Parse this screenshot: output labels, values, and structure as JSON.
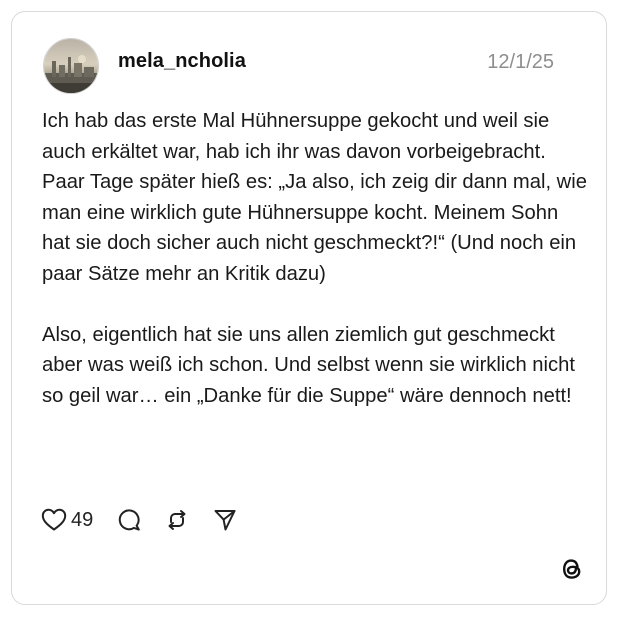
{
  "post": {
    "username": "mela_ncholia",
    "date": "12/1/25",
    "text": "Ich hab das erste Mal Hühnersuppe gekocht und weil sie auch erkältet war, hab ich ihr was davon vorbeigebracht. Paar Tage später hieß es: „Ja also, ich zeig dir dann mal, wie man eine wirklich gute Hühnersuppe kocht. Meinem Sohn hat sie doch sicher auch nicht geschmeckt?!“ (Und noch ein paar Sätze mehr an Kritik dazu)\n\nAlso, eigentlich hat sie uns allen ziemlich gut geschmeckt aber was weiß ich schon. Und selbst wenn sie wirklich nicht so geil war… ein „Danke für die Suppe“ wäre dennoch nett!",
    "like_count": "49"
  },
  "icons": {
    "avatar": "profile-photo-avatar",
    "like": "heart-icon",
    "comment": "comment-bubble-icon",
    "repost": "repost-icon",
    "share": "send-icon",
    "brand": "threads-logo-icon"
  },
  "colors": {
    "text": "#111111",
    "muted": "#8e8e8e",
    "border": "#d9d9d9"
  }
}
